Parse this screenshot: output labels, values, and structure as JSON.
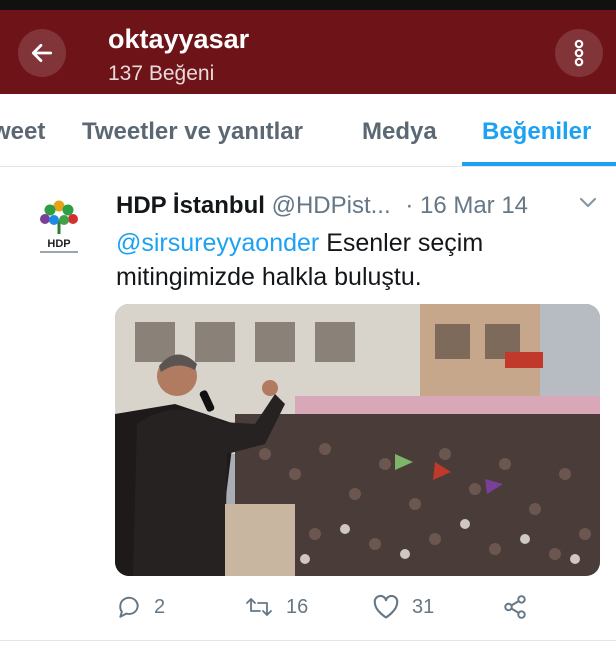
{
  "header": {
    "title": "oktayyasar",
    "subtitle": "137 Beğeni"
  },
  "tabs": [
    {
      "label": "weet"
    },
    {
      "label": "Tweetler ve yanıtlar"
    },
    {
      "label": "Medya"
    },
    {
      "label": "Beğeniler"
    }
  ],
  "tweet": {
    "author_name": "HDP İstanbul",
    "handle": "@HDPist...",
    "date": "· 16 Mar 14",
    "mention": "@sirsureyyaonder",
    "text": " Esenler seçim mitingimizde halkla buluştu.",
    "avatar_label": "HDP",
    "actions": {
      "replies": "2",
      "retweets": "16",
      "likes": "31"
    }
  },
  "colors": {
    "app_bar": "#6e1418",
    "accent": "#1da1f2",
    "muted": "#657786"
  }
}
